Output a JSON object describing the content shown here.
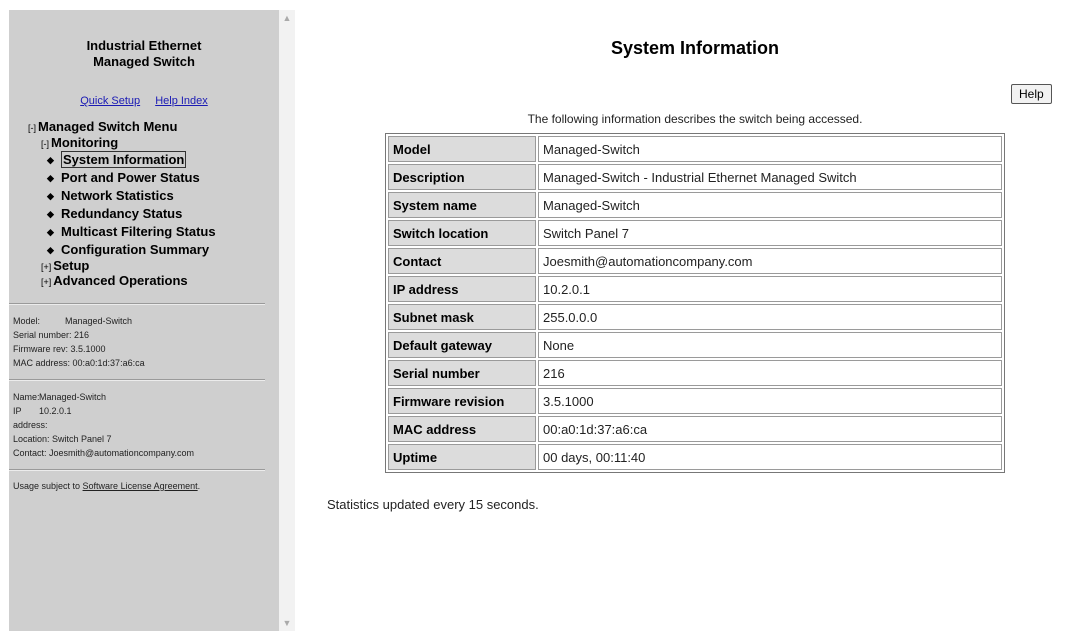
{
  "sidebar": {
    "brand_line1": "Industrial Ethernet",
    "brand_line2": "Managed Switch",
    "quick_setup": "Quick Setup",
    "help_index": "Help Index",
    "menu": {
      "root_toggle": "[-]",
      "root_label": "Managed Switch Menu",
      "monitoring_toggle": "[-]",
      "monitoring_label": "Monitoring",
      "items": [
        "System Information",
        "Port and Power Status",
        "Network Statistics",
        "Redundancy Status",
        "Multicast Filtering Status",
        "Configuration Summary"
      ],
      "setup_toggle": "[+]",
      "setup_label": "Setup",
      "advanced_toggle": "[+]",
      "advanced_label": "Advanced Operations"
    },
    "device": {
      "model_key": "Model:",
      "model_val": "Managed-Switch",
      "serial": "Serial number: 216",
      "firmware": "Firmware rev: 3.5.1000",
      "mac": "MAC address: 00:a0:1d:37:a6:ca"
    },
    "identity": {
      "name_key": "Name:",
      "name_val": "Managed-Switch",
      "ip_key": "IP",
      "ip_val": "10.2.0.1",
      "ip_key2": "address:",
      "location": "Location: Switch Panel 7",
      "contact": "Contact: Joesmith@automationcompany.com"
    },
    "license_prefix": "Usage subject to ",
    "license_link": "Software License Agreement",
    "license_suffix": "."
  },
  "main": {
    "title": "System Information",
    "help_button": "Help",
    "intro": "The following information describes the switch being accessed.",
    "rows": [
      {
        "label": "Model",
        "value": "Managed-Switch"
      },
      {
        "label": "Description",
        "value": "Managed-Switch - Industrial Ethernet Managed Switch"
      },
      {
        "label": "System name",
        "value": "Managed-Switch"
      },
      {
        "label": "Switch location",
        "value": "Switch Panel 7"
      },
      {
        "label": "Contact",
        "value": "Joesmith@automationcompany.com"
      },
      {
        "label": "IP address",
        "value": "10.2.0.1"
      },
      {
        "label": "Subnet mask",
        "value": "255.0.0.0"
      },
      {
        "label": "Default gateway",
        "value": "None"
      },
      {
        "label": "Serial number",
        "value": "216"
      },
      {
        "label": "Firmware revision",
        "value": "3.5.1000"
      },
      {
        "label": "MAC address",
        "value": "00:a0:1d:37:a6:ca"
      },
      {
        "label": "Uptime",
        "value": "00 days, 00:11:40"
      }
    ],
    "footer": "Statistics updated every 15 seconds."
  },
  "icons": {
    "bullet": "diamond-bullet-icon",
    "scroll_up": "scroll-up-icon",
    "scroll_down": "scroll-down-icon"
  },
  "colors": {
    "sidebar_bg": "#cfcfcf",
    "link": "#1a1ab4",
    "label_cell": "#dcdcdc"
  }
}
